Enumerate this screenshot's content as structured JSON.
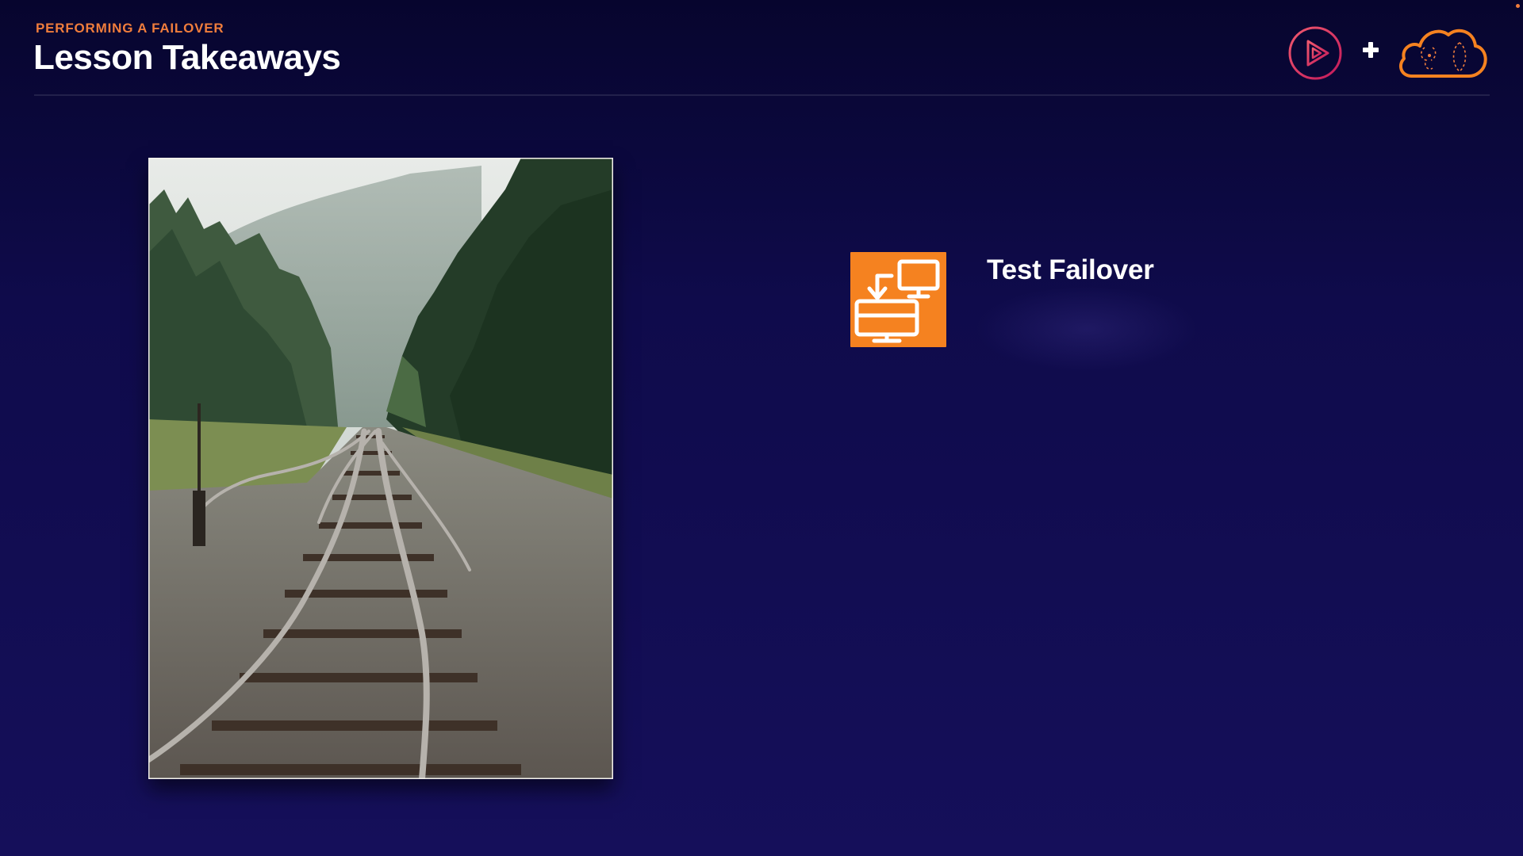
{
  "header": {
    "eyebrow": "PERFORMING A FAILOVER",
    "title": "Lesson Takeaways"
  },
  "logos": {
    "play": "play-logo-icon",
    "plus": "plus-icon",
    "cloud": "cloud-brains-logo-icon"
  },
  "image": {
    "subject": "railroad-tracks-photo",
    "icon": "railroad-switch-image"
  },
  "items": [
    {
      "icon": "failover-servers-icon",
      "label": "Test Failover"
    }
  ],
  "colors": {
    "background_top": "#07052e",
    "background_bottom": "#150f5a",
    "accent_orange": "#f07d3c",
    "icon_orange": "#f58220",
    "play_logo_pink": "#e03c6e",
    "white": "#ffffff"
  }
}
